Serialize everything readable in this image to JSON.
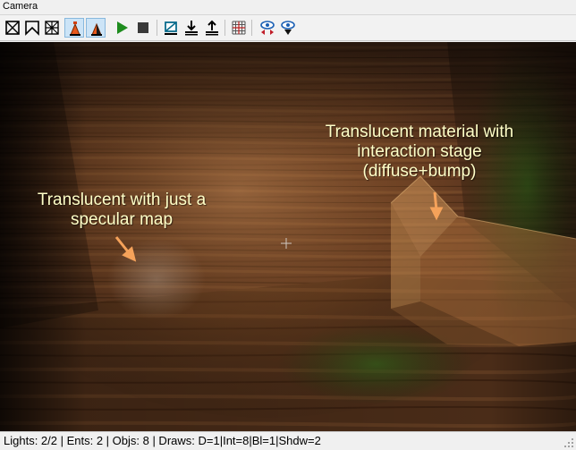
{
  "window": {
    "title": "Camera"
  },
  "toolbar": {
    "buttons": [
      {
        "name": "wireframe-toggle-icon"
      },
      {
        "name": "flat-shade-toggle-icon"
      },
      {
        "name": "checker-shade-toggle-icon"
      },
      {
        "name": "lighting-toggle-icon"
      },
      {
        "name": "light-mode-toggle-icon"
      },
      {
        "name": "play-icon"
      },
      {
        "name": "stop-icon"
      },
      {
        "name": "clip-toggle-icon"
      },
      {
        "name": "move-down-icon"
      },
      {
        "name": "move-up-icon"
      },
      {
        "name": "grid-toggle-icon"
      },
      {
        "name": "eye-split-icon"
      },
      {
        "name": "eye-down-icon"
      }
    ],
    "accent_color": "#1e8c1e"
  },
  "viewport": {
    "annotations": {
      "specular": {
        "line1": "Translucent with just a",
        "line2": "specular map"
      },
      "interaction": {
        "line1": "Translucent material with",
        "line2": "interaction stage",
        "line3": "(diffuse+bump)"
      }
    },
    "arrow_color": "#f5a25a",
    "label_color": "#ffffc8"
  },
  "status": {
    "text": "Lights: 2/2 | Ents: 2 | Objs: 8 | Draws: D=1|Int=8|Bl=1|Shdw=2"
  }
}
